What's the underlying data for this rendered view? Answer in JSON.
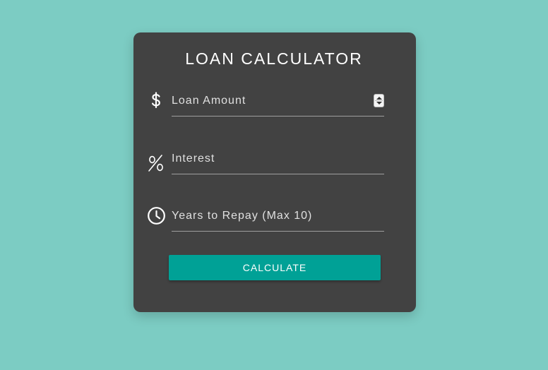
{
  "app": {
    "title": "LOAN CALCULATOR"
  },
  "colors": {
    "background": "#7cccc3",
    "card": "#424242",
    "accent": "#00a196"
  },
  "form": {
    "amount": {
      "icon": "dollar-sign-icon",
      "placeholder": "Loan Amount",
      "value": ""
    },
    "interest": {
      "icon": "percent-icon",
      "placeholder": "Interest",
      "value": ""
    },
    "years": {
      "icon": "clock-icon",
      "placeholder": "Years to Repay (Max 10)",
      "value": ""
    }
  },
  "actions": {
    "calculate_label": "CALCULATE"
  }
}
